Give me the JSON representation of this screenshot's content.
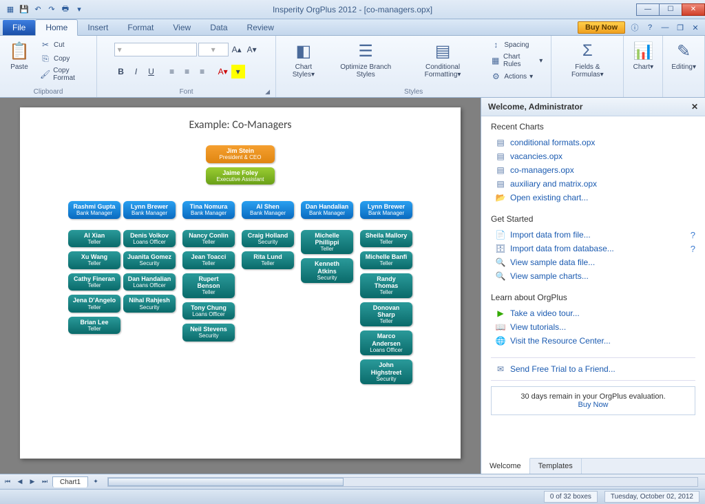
{
  "app": {
    "title": "Insperity OrgPlus 2012 - [co-managers.opx]"
  },
  "qat": [
    "save",
    "undo",
    "redo",
    "print"
  ],
  "tabs": {
    "file": "File",
    "items": [
      "Home",
      "Insert",
      "Format",
      "View",
      "Data",
      "Review"
    ],
    "active": "Home",
    "buynow": "Buy Now"
  },
  "ribbon": {
    "clipboard": {
      "label": "Clipboard",
      "paste": "Paste",
      "cut": "Cut",
      "copy": "Copy",
      "copyformat": "Copy Format"
    },
    "font": {
      "label": "Font"
    },
    "styles": {
      "label": "Styles",
      "chartstyles": "Chart\nStyles",
      "optimize": "Optimize\nBranch Styles",
      "conditional": "Conditional\nFormatting",
      "spacing": "Spacing",
      "chartrules": "Chart Rules",
      "actions": "Actions"
    },
    "fields": {
      "label": "Fields & Formulas"
    },
    "chart": {
      "label": "Chart"
    },
    "editing": {
      "label": "Editing"
    }
  },
  "chart": {
    "title": "Example: Co-Managers",
    "ceo": {
      "name": "Jim Stein",
      "title": "President & CEO"
    },
    "ea": {
      "name": "Jaime Foley",
      "title": "Executive Assistant"
    },
    "managers": [
      {
        "name": "Rashmi Gupta",
        "title": "Bank Manager"
      },
      {
        "name": "Lynn Brewer",
        "title": "Bank Manager"
      },
      {
        "name": "Tina Nomura",
        "title": "Bank Manager"
      },
      {
        "name": "Al Shen",
        "title": "Bank Manager"
      },
      {
        "name": "Dan Handalian",
        "title": "Bank Manager"
      },
      {
        "name": "Lynn Brewer",
        "title": "Bank Manager"
      }
    ],
    "col1a": [
      {
        "name": "Al Xian",
        "title": "Teller"
      },
      {
        "name": "Xu Wang",
        "title": "Teller"
      },
      {
        "name": "Cathy Fineran",
        "title": "Teller"
      },
      {
        "name": "Jena D'Angelo",
        "title": "Teller"
      },
      {
        "name": "Brian Lee",
        "title": "Teller"
      }
    ],
    "col1b": [
      {
        "name": "Denis Volkov",
        "title": "Loans Officer"
      },
      {
        "name": "Juanita Gomez",
        "title": "Security"
      },
      {
        "name": "Dan Handalian",
        "title": "Loans Officer"
      },
      {
        "name": "Nihal Rahjesh",
        "title": "Security"
      }
    ],
    "col2": [
      {
        "name": "Nancy Conlin",
        "title": "Teller"
      },
      {
        "name": "Jean Toacci",
        "title": "Teller"
      },
      {
        "name": "Rupert Benson",
        "title": "Teller"
      },
      {
        "name": "Tony Chung",
        "title": "Loans Officer"
      },
      {
        "name": "Neil Stevens",
        "title": "Security"
      }
    ],
    "col3": [
      {
        "name": "Craig Holland",
        "title": "Security"
      },
      {
        "name": "Rita Lund",
        "title": "Teller"
      }
    ],
    "col4": [
      {
        "name": "Michelle Phillippi",
        "title": "Teller"
      },
      {
        "name": "Kenneth Atkins",
        "title": "Security"
      }
    ],
    "col5": [
      {
        "name": "Sheila Mallory",
        "title": "Teller"
      },
      {
        "name": "Michelle Banfi",
        "title": "Teller"
      },
      {
        "name": "Randy Thomas",
        "title": "Teller"
      },
      {
        "name": "Donovan Sharp",
        "title": "Teller"
      },
      {
        "name": "Marco Andersen",
        "title": "Loans Officer"
      },
      {
        "name": "John Highstreet",
        "title": "Security"
      }
    ]
  },
  "sidepanel": {
    "header": "Welcome, Administrator",
    "recent": {
      "title": "Recent Charts",
      "items": [
        "conditional formats.opx",
        "vacancies.opx",
        "co-managers.opx",
        "auxiliary and matrix.opx"
      ],
      "open": "Open existing chart..."
    },
    "getstarted": {
      "title": "Get Started",
      "items": [
        "Import data from file...",
        "Import data from database...",
        "View sample data file...",
        "View sample charts..."
      ]
    },
    "learn": {
      "title": "Learn about OrgPlus",
      "items": [
        "Take a video tour...",
        "View tutorials...",
        "Visit the Resource Center..."
      ]
    },
    "sendtrial": "Send Free Trial to a Friend...",
    "eval": "30 days remain in your OrgPlus evaluation.",
    "buynow": "Buy Now",
    "tabs": [
      "Welcome",
      "Templates"
    ]
  },
  "bottom": {
    "sheet": "Chart1"
  },
  "status": {
    "boxes": "0 of 32 boxes",
    "date": "Tuesday, October 02, 2012"
  }
}
